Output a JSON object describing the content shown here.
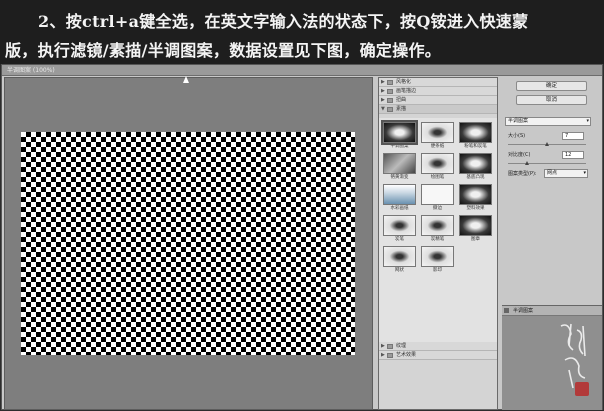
{
  "banner": {
    "line1": "2、按ctrl+a键全选，在英文字输入法的状态下，按Q铵进入快速蒙",
    "line2": "版，执行滤镜/素描/半调图案，数据设置见下图，确定操作。"
  },
  "window": {
    "title": "半调图案 (100%)"
  },
  "gallery": {
    "categories_top": [
      {
        "label": "风格化",
        "expanded": false
      },
      {
        "label": "画笔描边",
        "expanded": false
      },
      {
        "label": "扭曲",
        "expanded": false
      },
      {
        "label": "素描",
        "expanded": true
      }
    ],
    "thumbnails": [
      {
        "label": "半调图案",
        "style": "dk",
        "selected": true
      },
      {
        "label": "便条纸",
        "style": "lt",
        "selected": false
      },
      {
        "label": "粉笔和炭笔",
        "style": "dk",
        "selected": false
      },
      {
        "label": "铬黄渐变",
        "style": "gr",
        "selected": false
      },
      {
        "label": "绘图笔",
        "style": "lt",
        "selected": false
      },
      {
        "label": "基底凸现",
        "style": "dk",
        "selected": false
      },
      {
        "label": "水彩画纸",
        "style": "sky",
        "selected": false
      },
      {
        "label": "撕边",
        "style": "wh",
        "selected": false
      },
      {
        "label": "塑料效果",
        "style": "dk",
        "selected": false
      },
      {
        "label": "炭笔",
        "style": "lt",
        "selected": false
      },
      {
        "label": "炭精笔",
        "style": "lt",
        "selected": false
      },
      {
        "label": "图章",
        "style": "dk",
        "selected": false
      },
      {
        "label": "网状",
        "style": "lt",
        "selected": false
      },
      {
        "label": "影印",
        "style": "lt",
        "selected": false
      }
    ],
    "categories_bottom": [
      {
        "label": "纹理",
        "expanded": false
      },
      {
        "label": "艺术效果",
        "expanded": false
      }
    ]
  },
  "settings": {
    "ok_label": "确定",
    "cancel_label": "取消",
    "filter_name": "半调图案",
    "size_label": "大小(S)",
    "size_value": "7",
    "size_fraction": 0.5,
    "contrast_label": "对比度(C)",
    "contrast_value": "12",
    "contrast_fraction": 0.24,
    "pattern_type_label": "图案类型(P):",
    "pattern_type_value": "网点"
  },
  "layers": {
    "row_label": "半调图案"
  },
  "colors": {
    "banner_bg": "#1e1e1e",
    "preview_bg": "#7e7e7e",
    "seal": "#b23a3a"
  }
}
